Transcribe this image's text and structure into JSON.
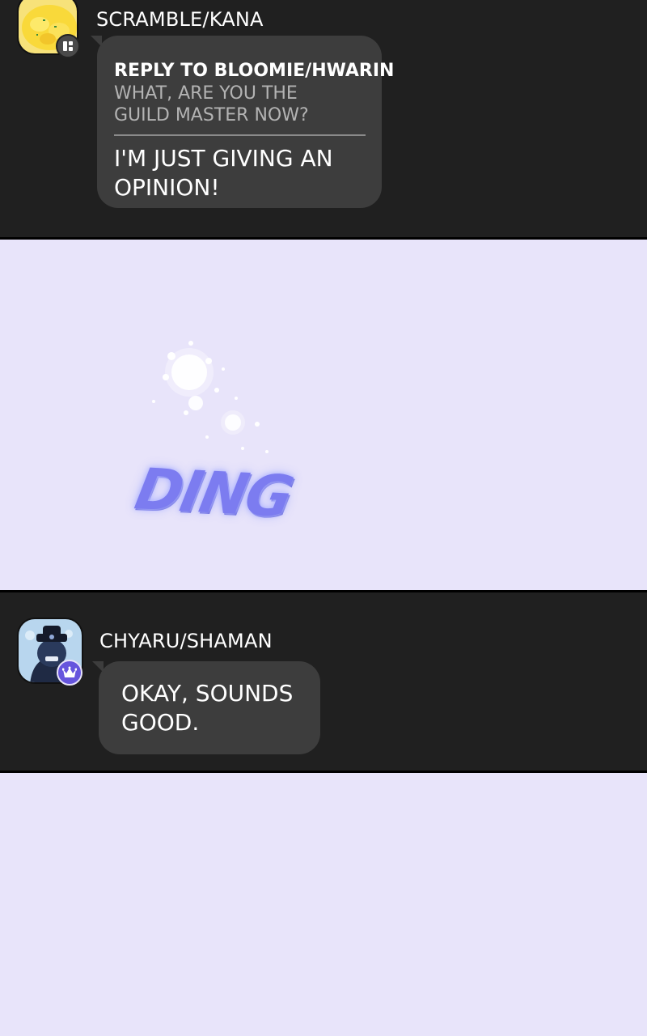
{
  "messages": [
    {
      "username": "SCRAMBLE/KANA",
      "reply": {
        "header": "REPLY TO BLOOMIE/HWARIN",
        "quote": "WHAT, ARE YOU THE GUILD MASTER NOW?"
      },
      "text": "I'M JUST GIVING AN OPINION!",
      "avatar_icon": "scrambled-egg-avatar",
      "badge_icon": "member-grid-icon"
    },
    {
      "username": "CHYARU/SHAMAN",
      "text": "OKAY, SOUNDS GOOD.",
      "avatar_icon": "hooded-character-avatar",
      "badge_icon": "crown-icon"
    }
  ],
  "sound_effect": {
    "text": "DING"
  },
  "colors": {
    "chat_background": "#202020",
    "bubble": "#3d3d3d",
    "page_background": "#e8e4fa",
    "sfx": "#7c7cf0",
    "master_badge": "#6655dd"
  }
}
